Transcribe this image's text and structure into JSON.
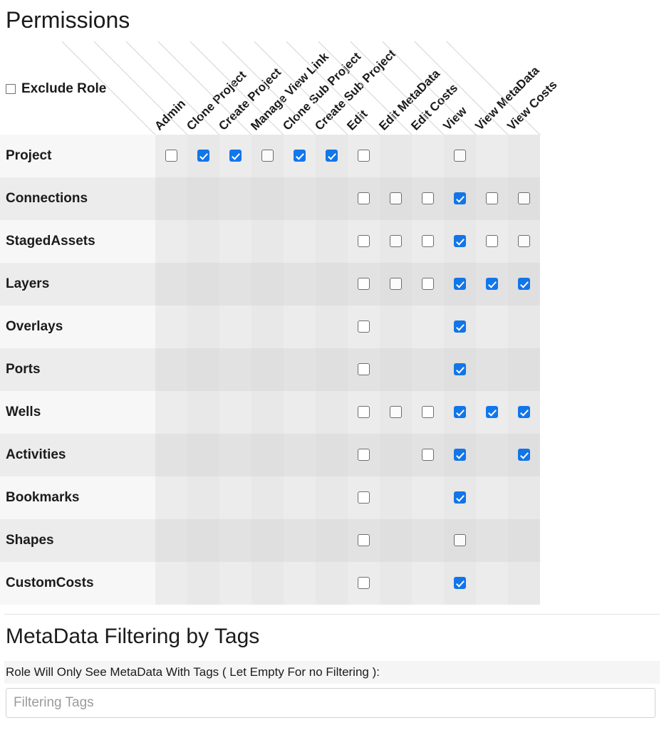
{
  "page": {
    "permissions_title": "Permissions",
    "metadata_title": "MetaData Filtering by Tags"
  },
  "exclude_role": {
    "label": "Exclude Role",
    "checked": false
  },
  "accent_color": "#1277ec",
  "table": {
    "columns": [
      "Admin",
      "Clone Project",
      "Create Project",
      "Manage View Link",
      "Clone Sub Project",
      "Create Sub Project",
      "Edit",
      "Edit MetaData",
      "Edit Costs",
      "View",
      "View MetaData",
      "View Costs"
    ],
    "rows": [
      {
        "label": "Project",
        "cells": [
          "off",
          "on",
          "on",
          "off",
          "on",
          "on",
          "off",
          null,
          null,
          "off",
          null,
          null
        ]
      },
      {
        "label": "Connections",
        "cells": [
          null,
          null,
          null,
          null,
          null,
          null,
          "off",
          "off",
          "off",
          "on",
          "off",
          "off"
        ]
      },
      {
        "label": "StagedAssets",
        "cells": [
          null,
          null,
          null,
          null,
          null,
          null,
          "off",
          "off",
          "off",
          "on",
          "off",
          "off"
        ]
      },
      {
        "label": "Layers",
        "cells": [
          null,
          null,
          null,
          null,
          null,
          null,
          "off",
          "off",
          "off",
          "on",
          "on",
          "on"
        ]
      },
      {
        "label": "Overlays",
        "cells": [
          null,
          null,
          null,
          null,
          null,
          null,
          "off",
          null,
          null,
          "on",
          null,
          null
        ]
      },
      {
        "label": "Ports",
        "cells": [
          null,
          null,
          null,
          null,
          null,
          null,
          "off",
          null,
          null,
          "on",
          null,
          null
        ]
      },
      {
        "label": "Wells",
        "cells": [
          null,
          null,
          null,
          null,
          null,
          null,
          "off",
          "off",
          "off",
          "on",
          "on",
          "on"
        ]
      },
      {
        "label": "Activities",
        "cells": [
          null,
          null,
          null,
          null,
          null,
          null,
          "off",
          null,
          "off",
          "on",
          null,
          "on"
        ]
      },
      {
        "label": "Bookmarks",
        "cells": [
          null,
          null,
          null,
          null,
          null,
          null,
          "off",
          null,
          null,
          "on",
          null,
          null
        ]
      },
      {
        "label": "Shapes",
        "cells": [
          null,
          null,
          null,
          null,
          null,
          null,
          "off",
          null,
          null,
          "off",
          null,
          null
        ]
      },
      {
        "label": "CustomCosts",
        "cells": [
          null,
          null,
          null,
          null,
          null,
          null,
          "off",
          null,
          null,
          "on",
          null,
          null
        ]
      }
    ]
  },
  "tag_filter": {
    "label": "Role Will Only See MetaData With Tags ( Let Empty For no Filtering ):",
    "placeholder": "Filtering Tags",
    "value": ""
  }
}
